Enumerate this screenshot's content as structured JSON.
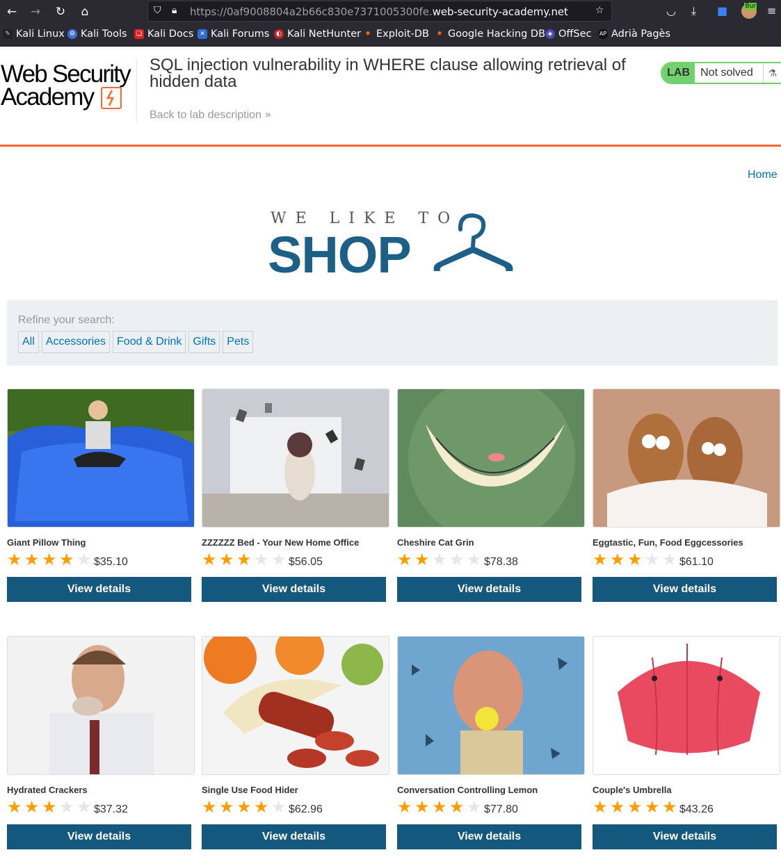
{
  "browser": {
    "url_prefix": "https://0af9008804a2b66c830e7371005300fe.",
    "url_domain": "web-security-academy.net",
    "icons": [
      "back-icon",
      "forward-icon",
      "reload-icon",
      "home-icon",
      "shield-icon",
      "lock-icon",
      "star-icon",
      "pocket-icon",
      "download-icon",
      "extension-icon",
      "burp-icon",
      "menu-icon"
    ],
    "bookmarks": [
      "Kali Linux",
      "Kali Tools",
      "Kali Docs",
      "Kali Forums",
      "Kali NetHunter",
      "Exploit-DB",
      "Google Hacking DB",
      "OffSec",
      "Adrià Pagès"
    ],
    "burp_badge": "Bur"
  },
  "lab": {
    "logo_line1": "Web Security",
    "logo_line2": "Academy",
    "title": "SQL injection vulnerability in WHERE clause allowing retrieval of hidden data",
    "back_link": "Back to lab description",
    "status_tag": "LAB",
    "status": "Not solved",
    "colors": {
      "accent": "#ff6633",
      "solved_green": "#70d16d",
      "button": "#14587e",
      "link": "#0071bc"
    }
  },
  "page": {
    "home": "Home",
    "logo_top": "WE LIKE TO",
    "logo_main": "SHOP",
    "refine_label": "Refine your search:",
    "filters": [
      "All",
      "Accessories",
      "Food & Drink",
      "Gifts",
      "Pets"
    ]
  },
  "products": [
    {
      "name": "Giant Pillow Thing",
      "rating": 4,
      "price": "$35.10",
      "button": "View details"
    },
    {
      "name": "ZZZZZZ Bed - Your New Home Office",
      "rating": 3,
      "price": "$56.05",
      "button": "View details"
    },
    {
      "name": "Cheshire Cat Grin",
      "rating": 2,
      "price": "$78.38",
      "button": "View details"
    },
    {
      "name": "Eggtastic, Fun, Food Eggcessories",
      "rating": 3,
      "price": "$61.10",
      "button": "View details"
    },
    {
      "name": "Hydrated Crackers",
      "rating": 3,
      "price": "$37.32",
      "button": "View details"
    },
    {
      "name": "Single Use Food Hider",
      "rating": 4,
      "price": "$62.96",
      "button": "View details"
    },
    {
      "name": "Conversation Controlling Lemon",
      "rating": 4,
      "price": "$77.80",
      "button": "View details"
    },
    {
      "name": "Couple's Umbrella",
      "rating": 5,
      "price": "$43.26",
      "button": "View details"
    }
  ]
}
